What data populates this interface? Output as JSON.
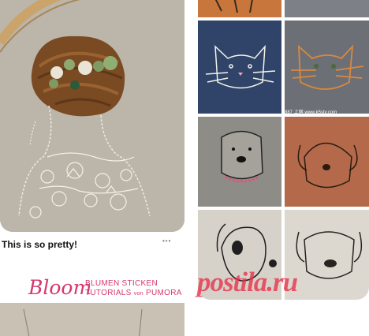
{
  "feed": {
    "pins": [
      {
        "title": "This is so pretty!",
        "more_label": "•••",
        "image_icon": "embroidered-woman-hair-bun-image"
      },
      {
        "logo_text": "Bloom",
        "subtitle_line1": "BLUMEN STICKEN",
        "subtitle_line2": "TUTORIALS",
        "subtitle_by": "von",
        "subtitle_brand": "PUMORA",
        "image_icon": "embroidered-flowers-image"
      },
      {
        "watermark": "postila.ru",
        "site_label": "887 上网 www.k5sty.com",
        "image_icon": "embroidered-cats-and-dogs-grid-image"
      }
    ]
  },
  "colors": {
    "watermark": "#e8304a",
    "bloom_pink": "#d6386b",
    "fabric": "#b7b1a6"
  }
}
